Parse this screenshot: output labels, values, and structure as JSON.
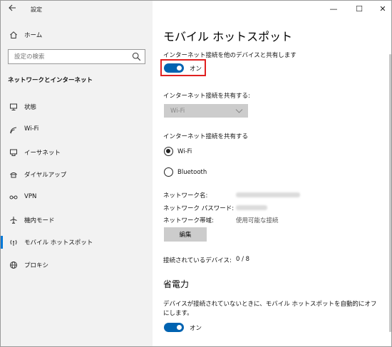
{
  "window": {
    "title": "設定",
    "controls": {
      "minimize": "—",
      "maximize": "☐",
      "close": "✕"
    }
  },
  "sidebar": {
    "home_label": "ホーム",
    "search_placeholder": "設定の検索",
    "section_title": "ネットワークとインターネット",
    "items": [
      {
        "label": "状態",
        "icon": "status-icon"
      },
      {
        "label": "Wi-Fi",
        "icon": "wifi-icon"
      },
      {
        "label": "イーサネット",
        "icon": "ethernet-icon"
      },
      {
        "label": "ダイヤルアップ",
        "icon": "dialup-icon"
      },
      {
        "label": "VPN",
        "icon": "vpn-icon"
      },
      {
        "label": "機内モード",
        "icon": "airplane-icon"
      },
      {
        "label": "モバイル ホットスポット",
        "icon": "hotspot-icon",
        "selected": true
      },
      {
        "label": "プロキシ",
        "icon": "globe-icon"
      }
    ]
  },
  "main": {
    "title": "モバイル ホットスポット",
    "share_label": "インターネット接続を他のデバイスと共有します",
    "share_toggle": {
      "state": "on",
      "label": "オン"
    },
    "share_from_label": "インターネット接続を共有する:",
    "share_from_value": "Wi-Fi",
    "share_over_label": "インターネット接続を共有する",
    "share_over_options": [
      {
        "label": "Wi-Fi",
        "checked": true
      },
      {
        "label": "Bluetooth",
        "checked": false
      }
    ],
    "network_name_label": "ネットワーク名:",
    "network_password_label": "ネットワーク パスワード:",
    "network_band_label": "ネットワーク帯域:",
    "network_band_value": "使用可能な接続",
    "edit_button": "編集",
    "connected_devices_label": "接続されているデバイス:",
    "connected_devices_value": "0 / 8",
    "power_saving_heading": "省電力",
    "power_saving_desc": "デバイスが接続されていないときに、モバイル ホットスポットを自動的にオフにします。",
    "power_saving_toggle": {
      "state": "on",
      "label": "オン"
    }
  },
  "colors": {
    "accent": "#0063b1",
    "selection_bar": "#0078d7",
    "highlight_box": "#e02020",
    "sidebar_bg": "#f2f2f2"
  }
}
